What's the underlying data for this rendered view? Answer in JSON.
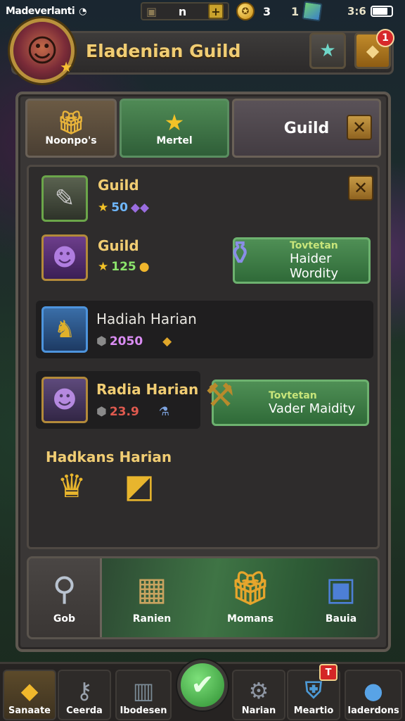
{
  "status_bar": {
    "carrier": "Madeverlanti",
    "time": "3:6"
  },
  "resources": {
    "amount_a": "n",
    "amount_b": "3",
    "amount_c": "1"
  },
  "header": {
    "title": "Eladenian Guild",
    "notification_count": "1"
  },
  "tabs": [
    {
      "label": "Noonpo's",
      "icon": "gift-box-icon"
    },
    {
      "label": "Mertel",
      "icon": "star-icon"
    },
    {
      "label": "Guild",
      "icon": "close-icon"
    }
  ],
  "rows": [
    {
      "name": "Guild",
      "stat": "50",
      "stat_color": "#6fb8ff",
      "action": null
    },
    {
      "name": "Guild",
      "stat": "125",
      "stat_color": "#8be36b",
      "action": {
        "tag": "Tovtetan",
        "label": "Haider Wordity"
      }
    },
    {
      "name": "Hadiah Harian",
      "stat": "2050",
      "stat_color": "#d98cf2",
      "action": null
    },
    {
      "name": "Radia Harian",
      "stat": "23.9",
      "stat_color": "#e05a4f",
      "action": {
        "tag": "Tovtetan",
        "label": "Vader Maidity"
      }
    }
  ],
  "section": {
    "title": "Hadkans Harian"
  },
  "bottom_tabs": [
    {
      "label": "Gob",
      "icon": "magnifier-icon"
    },
    {
      "label": "Ranien",
      "icon": "package-icon"
    },
    {
      "label": "Momans",
      "icon": "gift-box-icon"
    },
    {
      "label": "Bauia",
      "icon": "chest-icon"
    }
  ],
  "nav": [
    {
      "label": "Sanaate",
      "icon": "gold-bar-icon"
    },
    {
      "label": "Ceerda",
      "icon": "key-icon"
    },
    {
      "label": "Ibodesen",
      "icon": "box-icon"
    },
    {
      "label": "Narian",
      "icon": "gear-icon"
    },
    {
      "label": "Meartio",
      "icon": "shield-icon",
      "badge": "T"
    },
    {
      "label": "Iaderdons",
      "icon": "orb-icon"
    }
  ]
}
